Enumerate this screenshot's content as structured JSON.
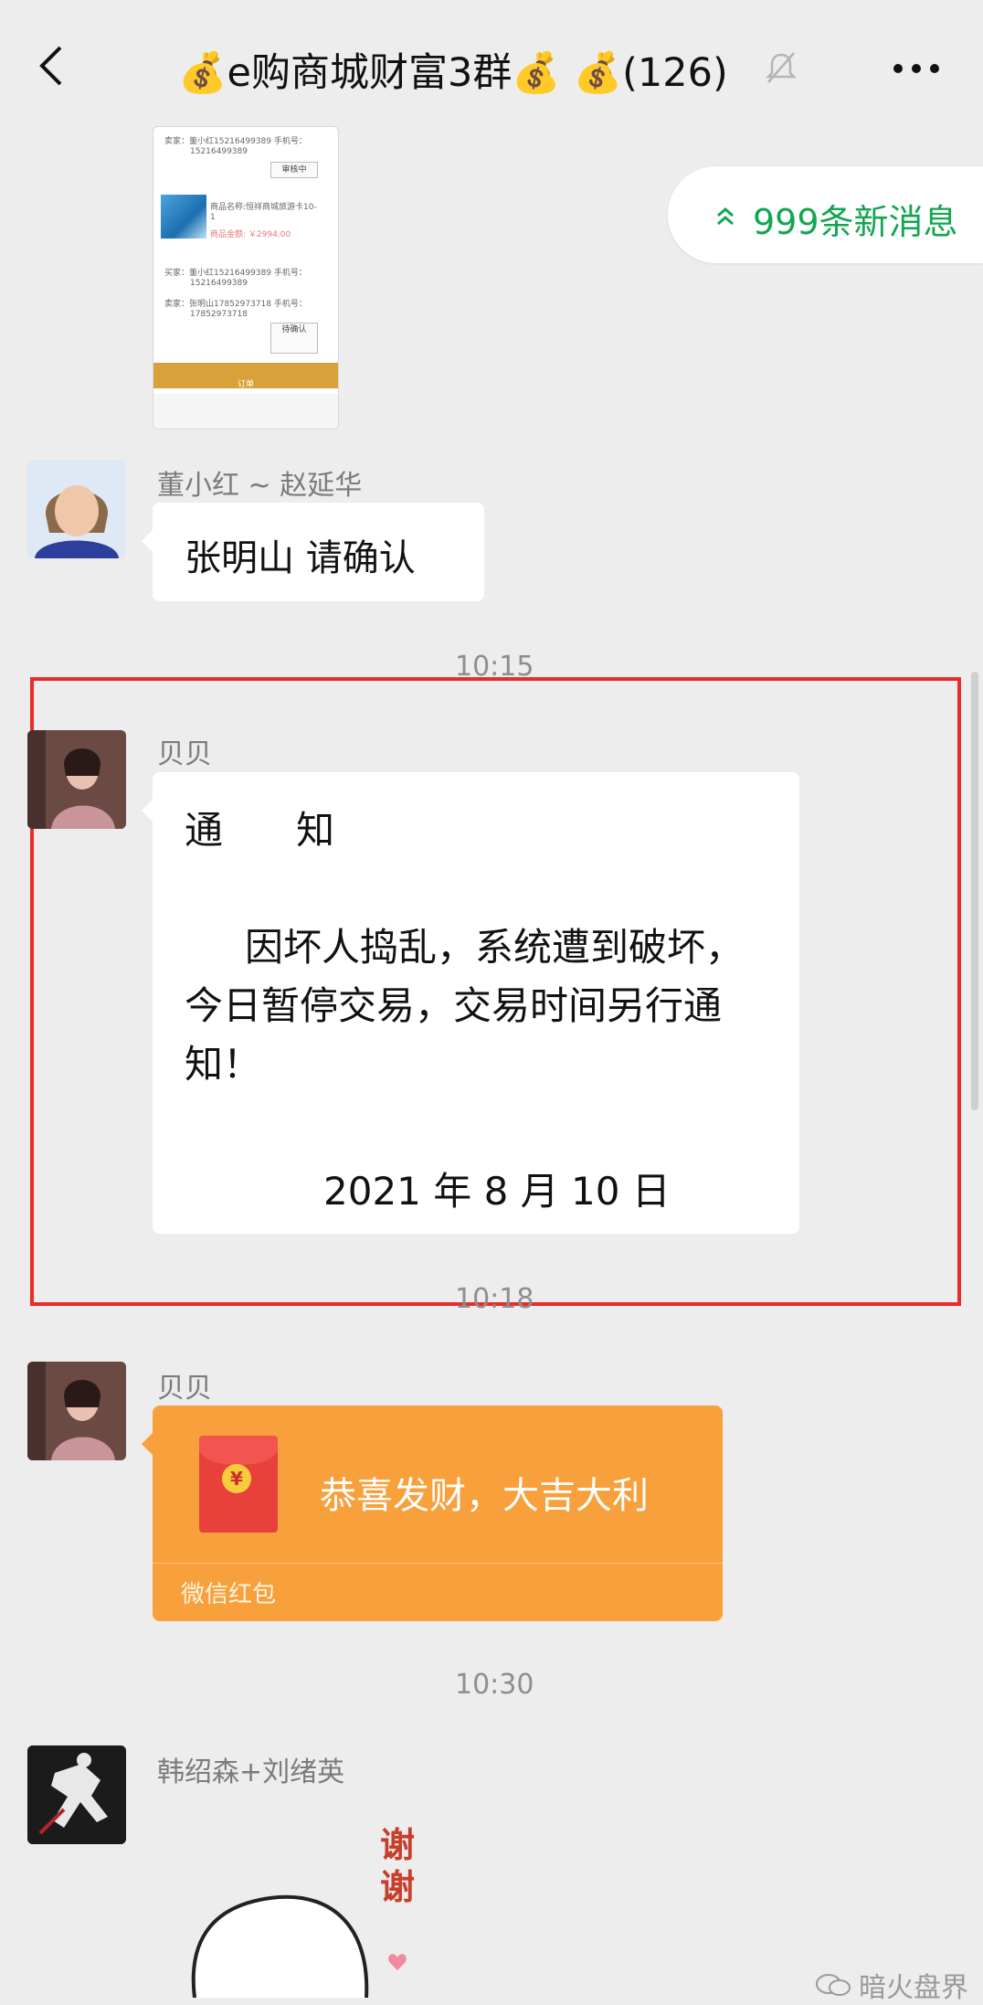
{
  "header": {
    "title": "💰e购商城财富3群💰 💰(126)",
    "back_icon": "chevron-left-icon",
    "mute_icon": "bell-off-icon",
    "more_icon": "ellipsis-icon"
  },
  "thumbnail": {
    "lines": [
      "卖家：董小红15216499389   手机号：",
      "15216499389",
      "商品名称:恒祥商城旅游卡10-",
      "1",
      "商品金额:   ￥2994.00",
      "买家：董小红15216499389   手机号：",
      "15216499389",
      "卖家：张明山17852973718   手机号：",
      "17852973718"
    ],
    "button1": "审核中",
    "button2": "待确认",
    "bar_label": "订单"
  },
  "new_messages": {
    "label": "999条新消息",
    "icon": "double-chevron-up-icon",
    "color": "#13a651"
  },
  "messages": [
    {
      "sender": "董小红 ~ 赵延华",
      "text": "张明山  请确认"
    },
    {
      "time": "10:15",
      "sender": "贝贝",
      "title": "通      知",
      "body": "因坏人捣乱，系统遭到破坏，今日暂停交易，交易时间另行通知！",
      "date": "2021 年 8 月 10 日"
    },
    {
      "time": "10:18",
      "sender": "贝贝",
      "red_packet_title": "恭喜发财，大吉大利",
      "red_packet_label": "微信红包",
      "red_packet_color": "#f8a03c"
    },
    {
      "time": "10:30",
      "sender": "韩绍森+刘绪英",
      "sticker_text": "谢谢"
    }
  ],
  "highlight_color": "#ea2b2b",
  "watermark": "暗火盘界"
}
